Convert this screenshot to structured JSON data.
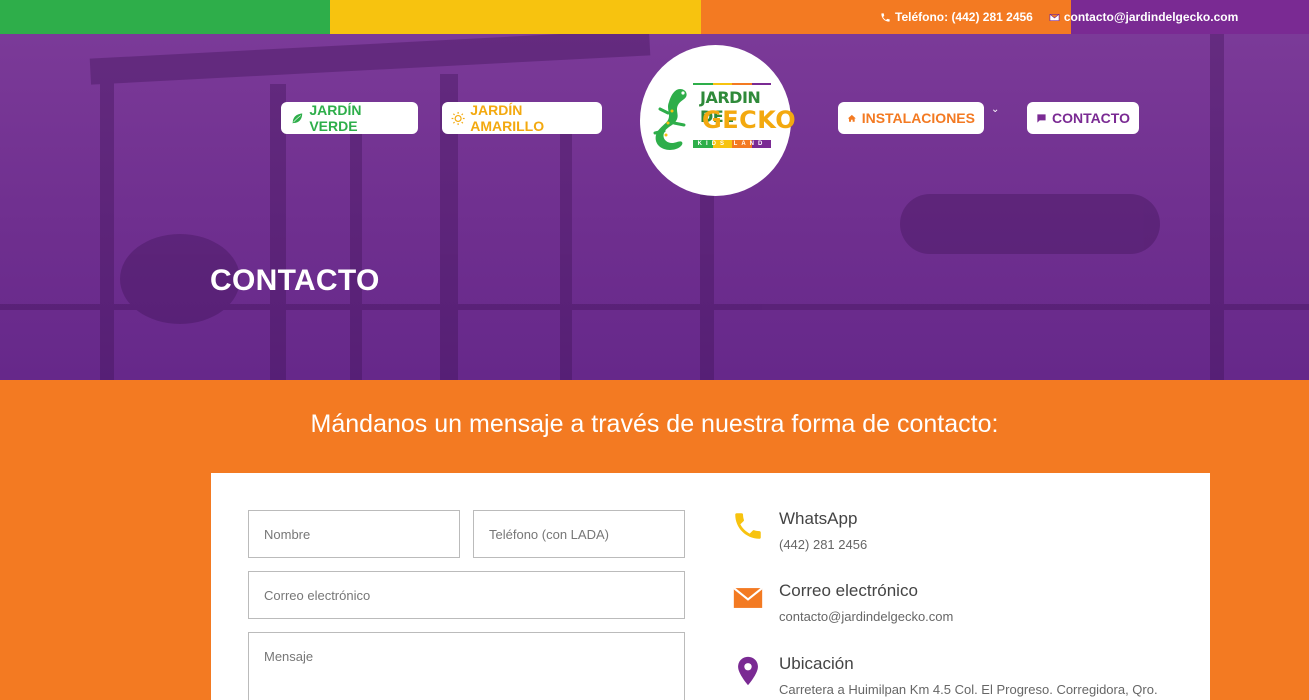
{
  "topbar": {
    "phone": "Teléfono: (442) 281 2456",
    "email": "contacto@jardindelgecko.com"
  },
  "nav": {
    "verde": "JARDÍN VERDE",
    "amarillo": "JARDÍN AMARILLO",
    "instalaciones": "INSTALACIONES",
    "contacto": "CONTACTO"
  },
  "logo": {
    "line1": "JARDIN DEL",
    "line2": "GECKO",
    "tagline": "KIDS LAND"
  },
  "hero": {
    "title": "CONTACTO"
  },
  "section": {
    "title": "Mándanos un mensaje a través de nuestra forma de contacto:"
  },
  "form": {
    "nombre_placeholder": "Nombre",
    "telefono_placeholder": "Teléfono (con LADA)",
    "correo_placeholder": "Correo electrónico",
    "mensaje_placeholder": "Mensaje"
  },
  "info": [
    {
      "icon": "phone-icon",
      "title": "WhatsApp",
      "value": "(442) 281 2456"
    },
    {
      "icon": "envelope-icon",
      "title": "Correo electrónico",
      "value": "contacto@jardindelgecko.com"
    },
    {
      "icon": "map-pin-icon",
      "title": "Ubicación",
      "value": "Carretera a Huimilpan Km 4.5 Col. El Progreso. Corregidora, Qro."
    }
  ],
  "colors": {
    "green": "#2eae4a",
    "yellow": "#f7c30f",
    "orange": "#f37a22",
    "purple": "#7a2a93"
  }
}
